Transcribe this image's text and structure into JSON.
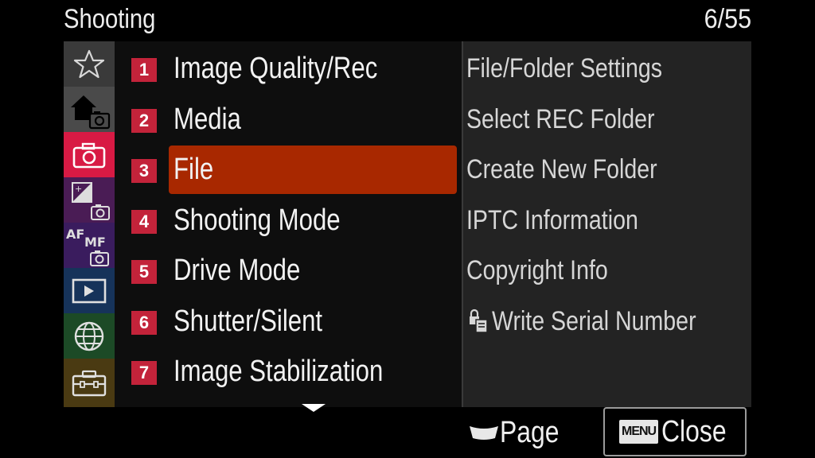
{
  "header": {
    "title": "Shooting",
    "page": "6/55"
  },
  "sidebar": {
    "tabs": [
      {
        "name": "my-menu",
        "icon": "star-icon",
        "color": "#3a3a3a"
      },
      {
        "name": "main",
        "icon": "home-camera-icon",
        "color": "#4a4a4a"
      },
      {
        "name": "shooting",
        "icon": "camera-icon",
        "color": "#d81a44",
        "selected": true
      },
      {
        "name": "exposure-color",
        "icon": "exposure-camera-icon",
        "color": "#4a1c55"
      },
      {
        "name": "focus",
        "icon": "af-mf-icon",
        "color": "#3a1c5e",
        "text_a": "AF",
        "text_b": "MF"
      },
      {
        "name": "playback",
        "icon": "play-icon",
        "color": "#16335a"
      },
      {
        "name": "network",
        "icon": "globe-icon",
        "color": "#1c4a26"
      },
      {
        "name": "setup",
        "icon": "toolbox-icon",
        "color": "#4a3a12"
      }
    ]
  },
  "categories": [
    {
      "num": "1",
      "label": "Image Quality/Rec"
    },
    {
      "num": "2",
      "label": "Media"
    },
    {
      "num": "3",
      "label": "File",
      "selected": true
    },
    {
      "num": "4",
      "label": "Shooting Mode"
    },
    {
      "num": "5",
      "label": "Drive Mode"
    },
    {
      "num": "6",
      "label": "Shutter/Silent"
    },
    {
      "num": "7",
      "label": "Image Stabilization"
    }
  ],
  "submenu": [
    {
      "label": "File/Folder Settings"
    },
    {
      "label": "Select REC Folder"
    },
    {
      "label": "Create New Folder"
    },
    {
      "label": "IPTC Information"
    },
    {
      "label": "Copyright Info"
    },
    {
      "label": "Write Serial Number",
      "icon": "lock-doc-icon"
    }
  ],
  "footer": {
    "page_label": "Page",
    "page_icon": "control-wheel-icon",
    "menu_key": "MENU",
    "close_label": "Close"
  },
  "colors": {
    "selection": "#a82800",
    "number_badge": "#c3233a",
    "shooting_tab": "#d81a44"
  }
}
